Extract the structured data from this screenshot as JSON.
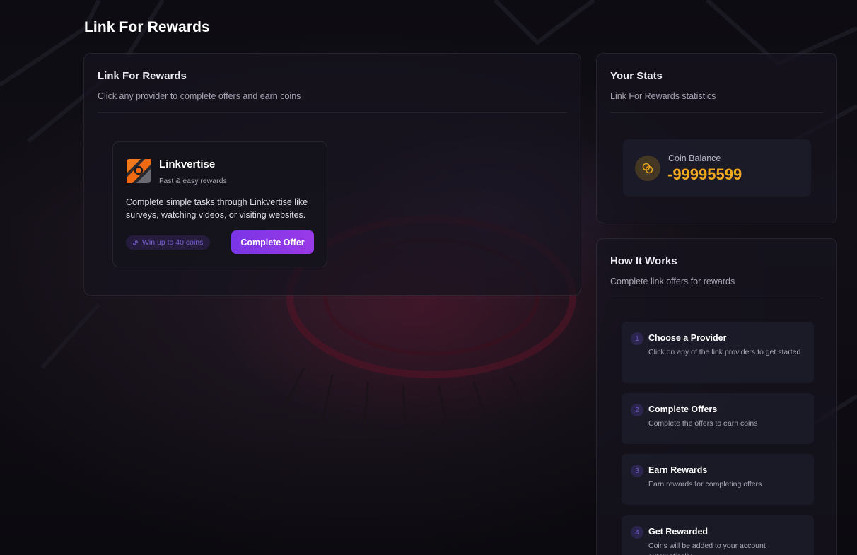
{
  "page": {
    "title": "Link For Rewards"
  },
  "main_card": {
    "title": "Link For Rewards",
    "subtitle": "Click any provider to complete offers and earn coins",
    "providers": [
      {
        "name": "Linkvertise",
        "tagline": "Fast & easy rewards",
        "description": "Complete simple tasks through Linkvertise like surveys, watching videos, or visiting websites.",
        "reward_label": "Win up to 40 coins",
        "button_label": "Complete Offer",
        "logo_icon": "linkvertise-logo",
        "reward_icon": "link-icon"
      }
    ]
  },
  "stats_card": {
    "title": "Your Stats",
    "subtitle": "Link For Rewards statistics",
    "balance_label": "Coin Balance",
    "balance_value": "-99995599",
    "balance_icon": "coins-icon"
  },
  "how_card": {
    "title": "How It Works",
    "subtitle": "Complete link offers for rewards",
    "steps": [
      {
        "number": "1",
        "title": "Choose a Provider",
        "description": "Click on any of the link providers to get started"
      },
      {
        "number": "2",
        "title": "Complete Offers",
        "description": "Complete the offers to earn coins"
      },
      {
        "number": "3",
        "title": "Earn Rewards",
        "description": "Earn rewards for completing offers"
      },
      {
        "number": "4",
        "title": "Get Rewarded",
        "description": "Coins will be added to your account automatically"
      }
    ]
  },
  "colors": {
    "accent": "#8a38e8",
    "coin": "#f1a81e",
    "background": "#0b0a10"
  }
}
